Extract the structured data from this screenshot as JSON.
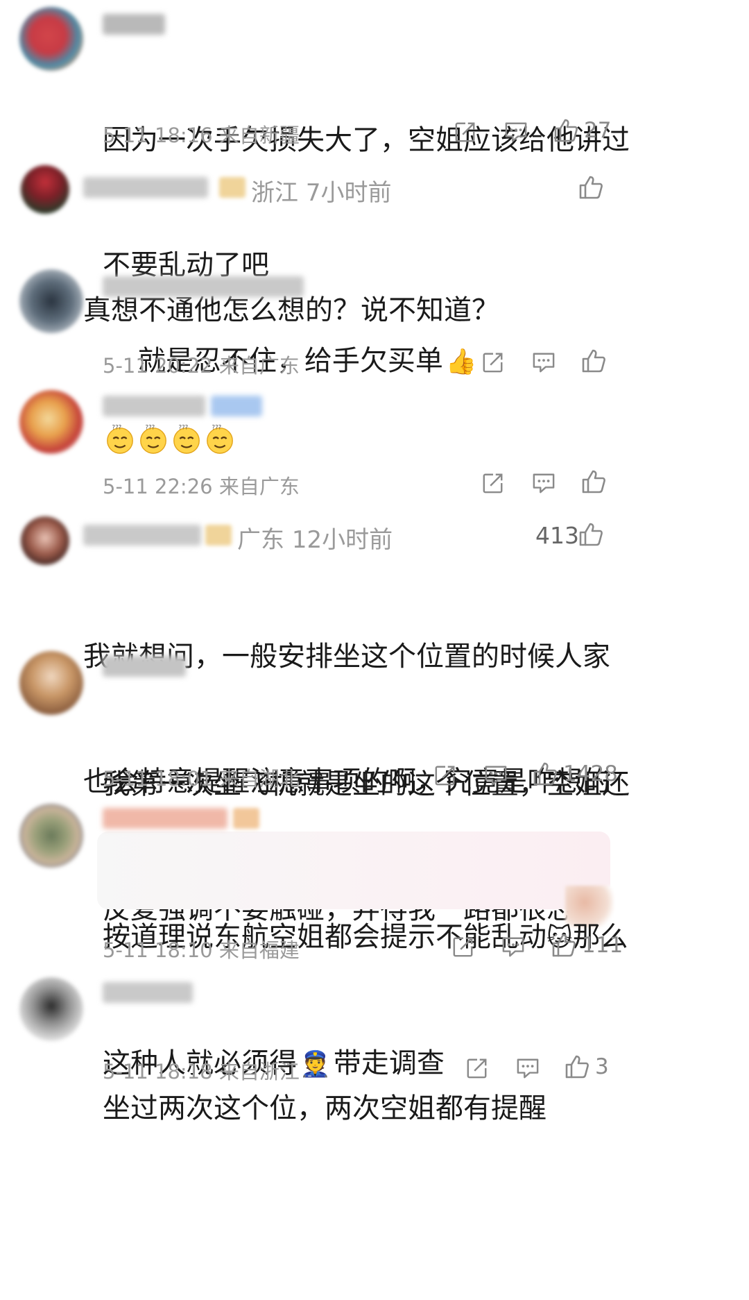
{
  "colors": {
    "meta_gray": "#9a9a9a",
    "text": "#1a1a1a",
    "highlight_bg": "#fbf1f4"
  },
  "comments": [
    {
      "text_lines": [
        "因为一次手欠损失大了，空姐应该给他讲过",
        "不要乱动了吧"
      ],
      "time": "5-11 18:16",
      "from": "来自新疆",
      "likes": "27"
    },
    {
      "location": "浙江",
      "ago": "7小时前",
      "text_lines": [
        "真想不通他怎么想的？说不知道？"
      ]
    },
    {
      "text_lines": [
        "就是忍不住，给手欠买单"
      ],
      "emoji": "thumbs-up-emoji",
      "time": "5-11 20:22",
      "from": "来自广东"
    },
    {
      "emoji_row": [
        "dizzy-face-emoji",
        "dizzy-face-emoji",
        "dizzy-face-emoji",
        "dizzy-face-emoji"
      ],
      "time": "5-11 22:26",
      "from": "来自广东"
    },
    {
      "location": "广东",
      "ago": "12小时前",
      "likes": "413",
      "text_lines": [
        "我就想问，一般安排坐这个位置的时候人家",
        "也会特意提醒注意事项的啊，究竟是咋想的"
      ]
    },
    {
      "text_lines": [
        "我第一次坐飞机就是坐的这个位置，空姐还",
        "反复强调不要触碰，弄得我一路都很忐忑"
      ],
      "time": "5-11 18:01",
      "from": "来自湖北",
      "likes": "1428"
    },
    {
      "text_lines_a": [
        "按道理说东航空姐都会提示不能乱动",
        "那么"
      ],
      "text_lines_b": [
        "这种人就必须得",
        "带走调查"
      ],
      "emoji_cat": "cat-face-emoji",
      "emoji_police": "police-officer-emoji",
      "time": "5-11 18:10",
      "from": "来自福建",
      "likes": "111"
    },
    {
      "text_lines": [
        "坐过两次这个位，两次空姐都有提醒"
      ],
      "time": "5-11 18:18",
      "from": "来自浙江",
      "likes": "3"
    }
  ]
}
